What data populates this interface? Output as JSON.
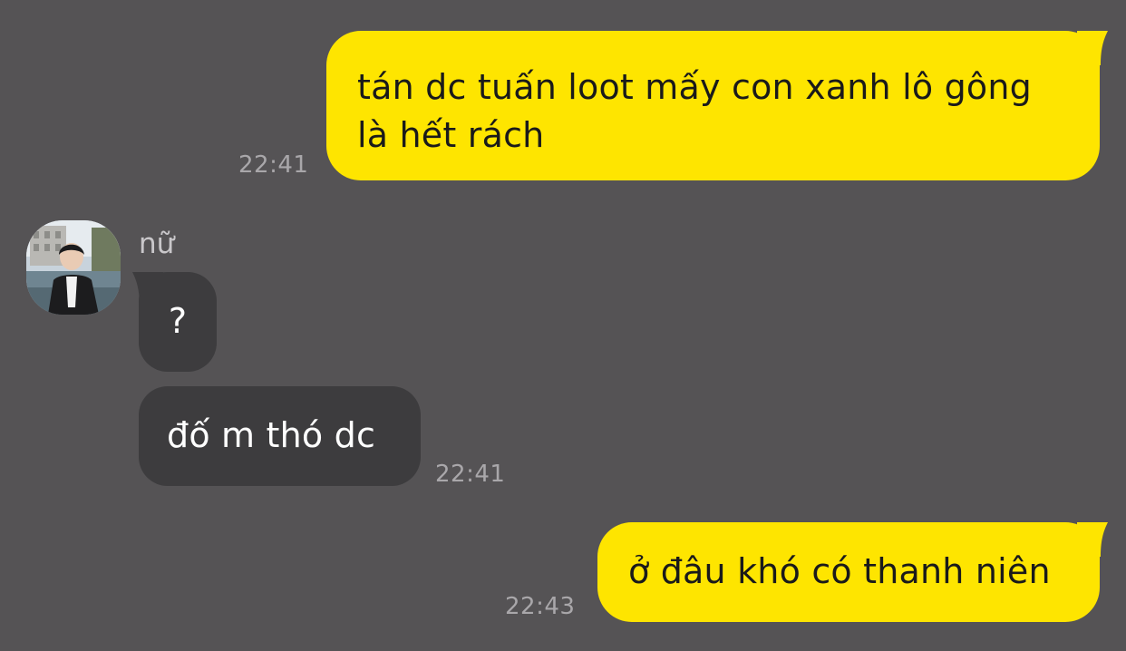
{
  "colors": {
    "background": "#555355",
    "outgoing_bubble": "#FEE500",
    "incoming_bubble": "#3D3C3E",
    "timestamp": "#A9A7AA"
  },
  "messages": [
    {
      "direction": "outgoing",
      "lines": [
        "tán dc tuấn loot mấy con xanh lô gông",
        "là hết rách"
      ],
      "time": "22:41"
    },
    {
      "direction": "incoming",
      "sender": "nữ",
      "avatar": "profile-photo",
      "text": "?"
    },
    {
      "direction": "incoming",
      "text": "đố m thó dc",
      "time": "22:41"
    },
    {
      "direction": "outgoing",
      "text": "ở đâu khó có thanh niên",
      "time": "22:43"
    }
  ]
}
